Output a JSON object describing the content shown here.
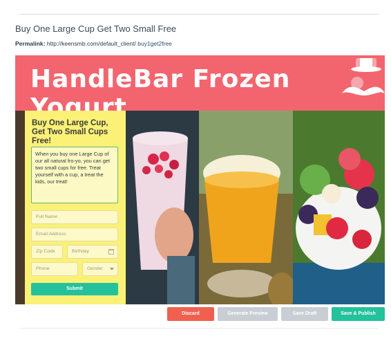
{
  "campaign": {
    "title": "Buy One Large Cup Get Two Small Free",
    "permalink_label": "Permalink:",
    "permalink_base": "http://keensmb.com/default_client/",
    "permalink_slug": "buy1get2free"
  },
  "banner": {
    "brand": "HandleBar Frozen Yogurt",
    "color": "#f2656f"
  },
  "form": {
    "heading": "Buy One Large Cup, Get Two Small Cups Free!",
    "message": "When you buy one Large Cup of our all natural fro-yo, you can get two small cups for free. Treat yourself with a cup, a treat the kids, our treat!",
    "full_name_placeholder": "Full Name",
    "email_placeholder": "Email Address",
    "zip_placeholder": "Zip Code",
    "birthday_placeholder": "Birthday",
    "phone_placeholder": "Phone",
    "gender_placeholder": "Gender",
    "submit_label": "Submit",
    "panel_color": "#faf176",
    "submit_color": "#23c19c"
  },
  "actions": {
    "discard": "Discard",
    "generate_preview": "Generate Preview",
    "save_draft": "Save Draft",
    "save_publish": "Save & Publish",
    "discard_color": "#f0604f",
    "neutral_color": "#c8ced4",
    "publish_color": "#23c19c"
  }
}
